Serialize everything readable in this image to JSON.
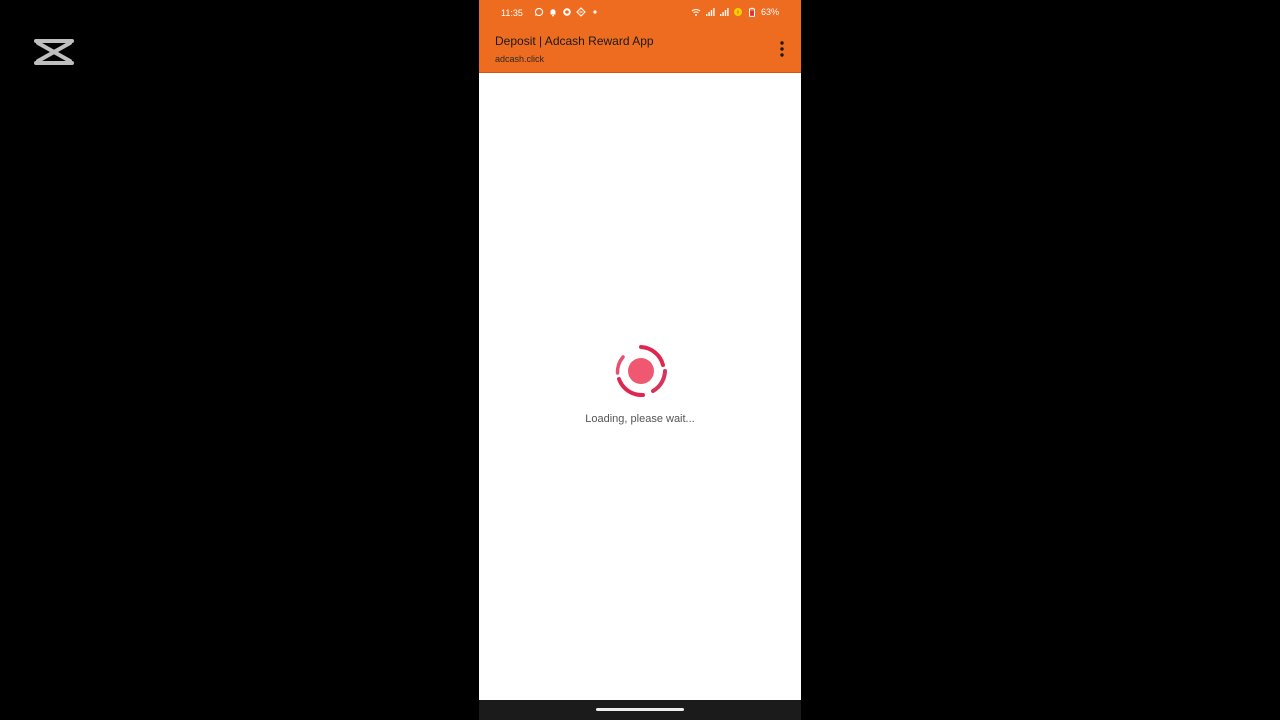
{
  "status_bar": {
    "time": "11:35",
    "battery_percent": "63%"
  },
  "toolbar": {
    "title": "Deposit | Adcash Reward App",
    "url": "adcash.click"
  },
  "content": {
    "loading_text": "Loading, please wait..."
  },
  "colors": {
    "toolbar_bg": "#ee6c1f",
    "spinner_red": "#e0264f",
    "spinner_dot": "#f05872"
  },
  "icons": {
    "watermark": "capcut-logo-icon",
    "menu": "more-vert-icon"
  }
}
